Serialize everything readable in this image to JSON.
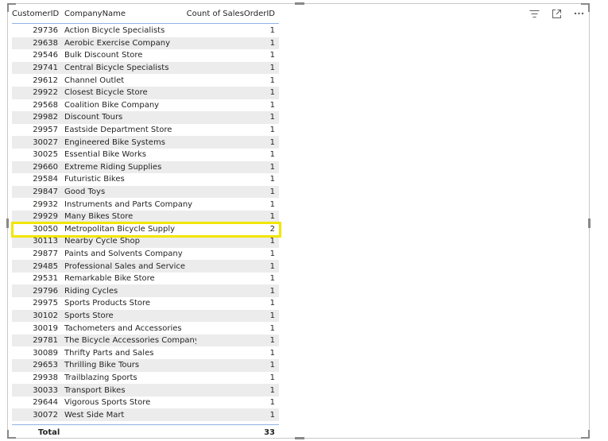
{
  "table": {
    "headers": [
      "CustomerID",
      "CompanyName",
      "Count of SalesOrderID"
    ],
    "rows": [
      [
        "29736",
        "Action Bicycle Specialists",
        "1"
      ],
      [
        "29638",
        "Aerobic Exercise Company",
        "1"
      ],
      [
        "29546",
        "Bulk Discount Store",
        "1"
      ],
      [
        "29741",
        "Central Bicycle Specialists",
        "1"
      ],
      [
        "29612",
        "Channel Outlet",
        "1"
      ],
      [
        "29922",
        "Closest Bicycle Store",
        "1"
      ],
      [
        "29568",
        "Coalition Bike Company",
        "1"
      ],
      [
        "29982",
        "Discount Tours",
        "1"
      ],
      [
        "29957",
        "Eastside Department Store",
        "1"
      ],
      [
        "30027",
        "Engineered Bike Systems",
        "1"
      ],
      [
        "30025",
        "Essential Bike Works",
        "1"
      ],
      [
        "29660",
        "Extreme Riding Supplies",
        "1"
      ],
      [
        "29584",
        "Futuristic Bikes",
        "1"
      ],
      [
        "29847",
        "Good Toys",
        "1"
      ],
      [
        "29932",
        "Instruments and Parts Company",
        "1"
      ],
      [
        "29929",
        "Many Bikes Store",
        "1"
      ],
      [
        "30050",
        "Metropolitan Bicycle Supply",
        "2"
      ],
      [
        "30113",
        "Nearby Cycle Shop",
        "1"
      ],
      [
        "29877",
        "Paints and Solvents Company",
        "1"
      ],
      [
        "29485",
        "Professional Sales and Service",
        "1"
      ],
      [
        "29531",
        "Remarkable Bike Store",
        "1"
      ],
      [
        "29796",
        "Riding Cycles",
        "1"
      ],
      [
        "29975",
        "Sports Products Store",
        "1"
      ],
      [
        "30102",
        "Sports Store",
        "1"
      ],
      [
        "30019",
        "Tachometers and Accessories",
        "1"
      ],
      [
        "29781",
        "The Bicycle Accessories Company",
        "1"
      ],
      [
        "30089",
        "Thrifty Parts and Sales",
        "1"
      ],
      [
        "29653",
        "Thrilling Bike Tours",
        "1"
      ],
      [
        "29938",
        "Trailblazing Sports",
        "1"
      ],
      [
        "30033",
        "Transport Bikes",
        "1"
      ],
      [
        "29644",
        "Vigorous Sports Store",
        "1"
      ],
      [
        "30072",
        "West Side Mart",
        "1"
      ]
    ],
    "total_label": "Total",
    "total_value": "33",
    "highlighted_row_index": 16
  },
  "toolbar": {
    "icons": [
      "filter-icon",
      "focus-mode-icon",
      "more-options-icon"
    ]
  },
  "colors": {
    "highlight": "#f2e600",
    "header_rule": "#8fb4e3",
    "zebra": "#ececec"
  }
}
